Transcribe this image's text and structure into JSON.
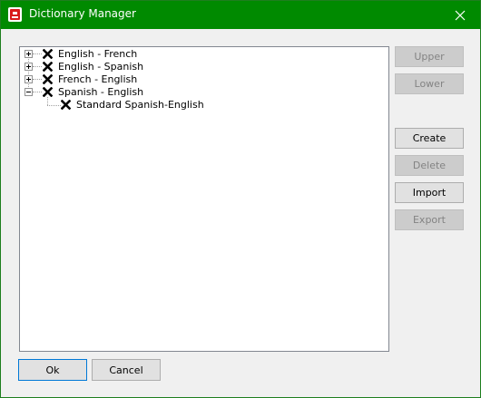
{
  "window": {
    "title": "Dictionary Manager",
    "app_icon": "dictionary-app-icon",
    "close_icon": "close-icon"
  },
  "tree": {
    "nodes": [
      {
        "label": "English - French",
        "expander": "plus",
        "checked": true
      },
      {
        "label": "English - Spanish",
        "expander": "plus",
        "checked": true
      },
      {
        "label": "French - English",
        "expander": "plus",
        "checked": true
      },
      {
        "label": "Spanish - English",
        "expander": "minus",
        "checked": true,
        "children": [
          {
            "label": "Standard Spanish-English",
            "checked": true
          }
        ]
      }
    ]
  },
  "side_buttons": {
    "upper": {
      "label": "Upper",
      "enabled": false
    },
    "lower": {
      "label": "Lower",
      "enabled": false
    },
    "create": {
      "label": "Create",
      "enabled": true
    },
    "delete": {
      "label": "Delete",
      "enabled": false
    },
    "import": {
      "label": "Import",
      "enabled": true
    },
    "export": {
      "label": "Export",
      "enabled": false
    }
  },
  "bottom_buttons": {
    "ok": {
      "label": "Ok"
    },
    "cancel": {
      "label": "Cancel"
    }
  },
  "colors": {
    "titlebar": "#008a00",
    "check_mark": "#000000"
  }
}
